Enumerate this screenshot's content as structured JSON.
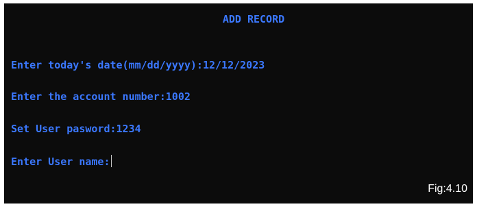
{
  "terminal": {
    "title": "ADD RECORD",
    "lines": [
      "Enter today's date(mm/dd/yyyy):12/12/2023",
      "Enter the account number:1002",
      "Set User pasword:1234",
      "Enter User name:"
    ],
    "text_color": "#3b78ff",
    "background_color": "#0c0c0c"
  },
  "figure_caption": "Fig:4.10"
}
